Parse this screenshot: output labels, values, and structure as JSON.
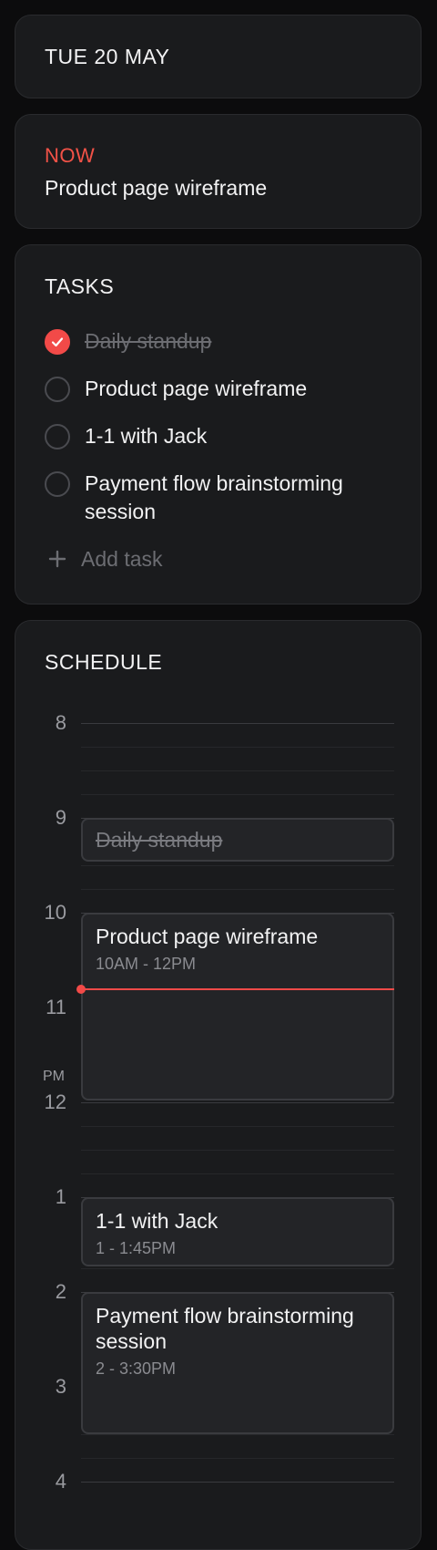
{
  "date": "TUE 20 MAY",
  "now": {
    "label": "NOW",
    "title": "Product page wireframe"
  },
  "tasks": {
    "title": "TASKS",
    "items": [
      {
        "label": "Daily standup",
        "done": true
      },
      {
        "label": "Product page wireframe",
        "done": false
      },
      {
        "label": "1-1 with Jack",
        "done": false
      },
      {
        "label": "Payment flow brainstorming session",
        "done": false
      }
    ],
    "add_label": "Add task"
  },
  "schedule": {
    "title": "SCHEDULE",
    "hours": [
      "8",
      "9",
      "10",
      "11",
      "12",
      "1",
      "2",
      "3",
      "4"
    ],
    "pm_label": "PM",
    "events": [
      {
        "title": "Daily standup",
        "time": "",
        "done": true
      },
      {
        "title": "Product page wireframe",
        "time": "10AM - 12PM",
        "done": false
      },
      {
        "title": "1-1 with Jack",
        "time": "1 - 1:45PM",
        "done": false
      },
      {
        "title": "Payment flow brainstorming session",
        "time": "2 - 3:30PM",
        "done": false
      }
    ]
  },
  "colors": {
    "accent": "#f24a48",
    "background": "#0c0c0d",
    "card": "#1a1b1d"
  },
  "icons": {
    "check": "checkmark-icon",
    "add": "plus-icon"
  }
}
